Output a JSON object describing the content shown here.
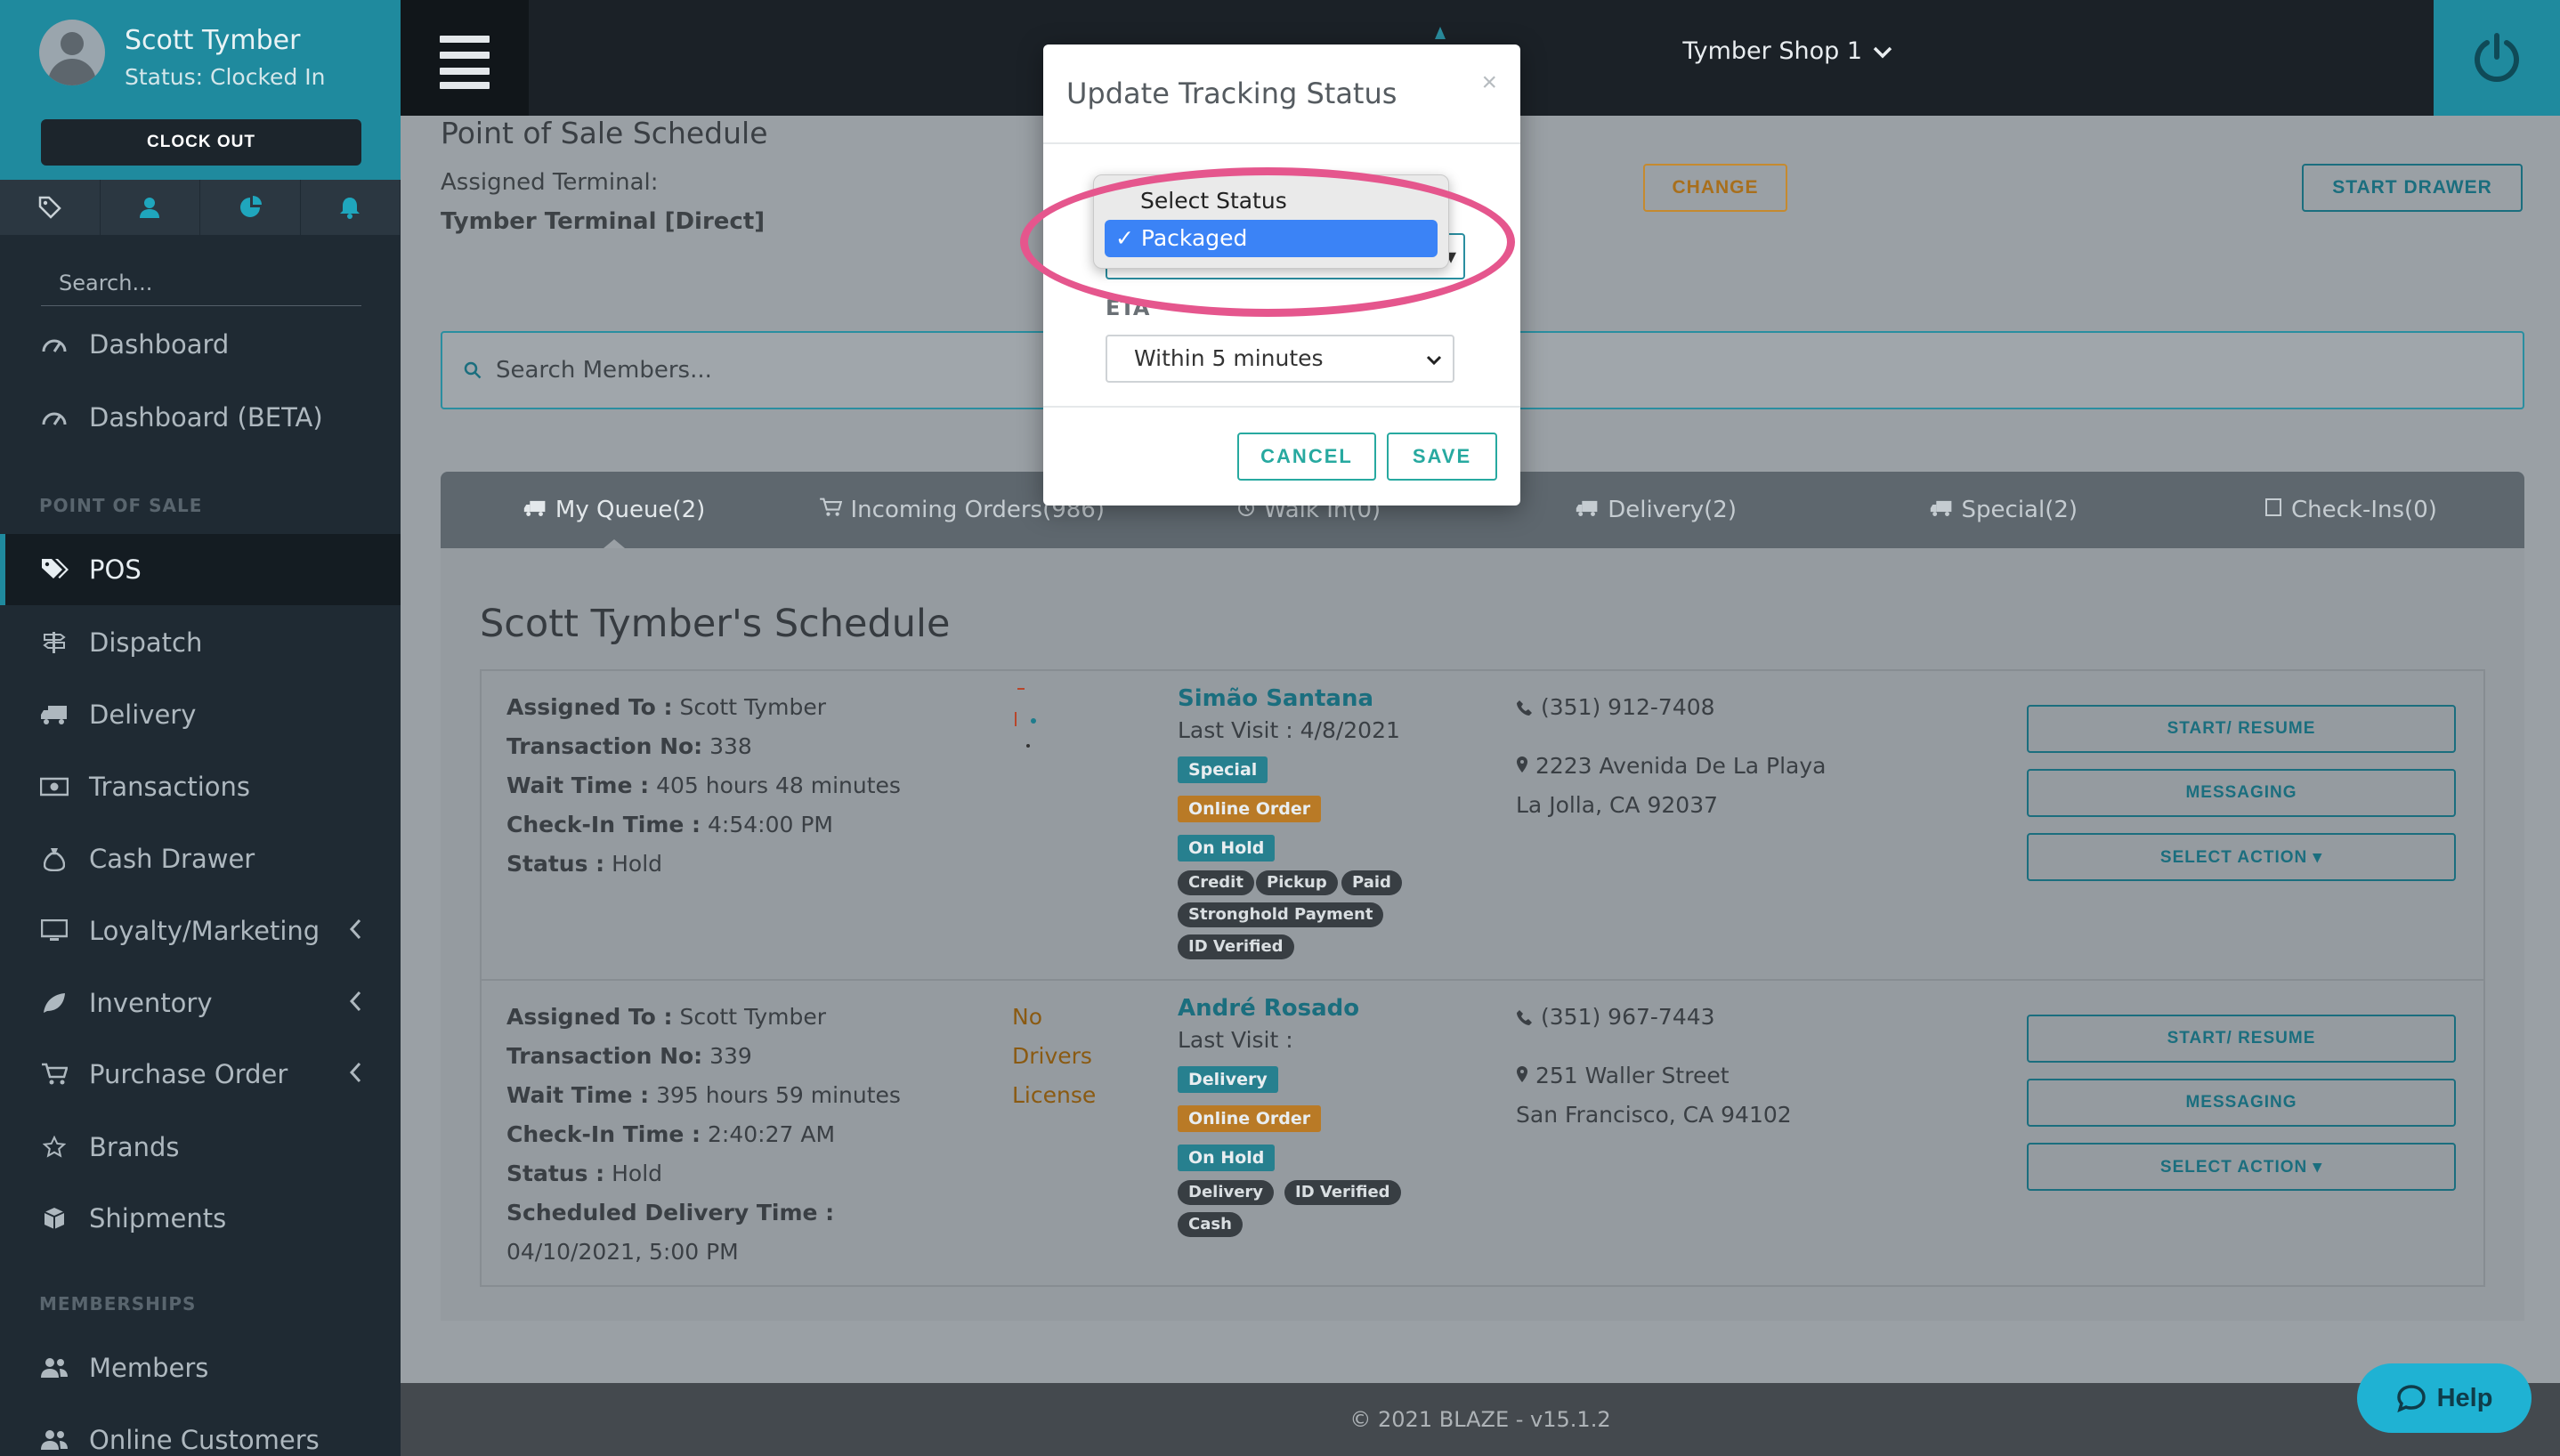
{
  "user": {
    "name": "Scott Tymber",
    "status": "Status: Clocked In",
    "clockout_label": "CLOCK OUT"
  },
  "sidebar": {
    "search_placeholder": "Search...",
    "sections": {
      "pos": "POINT OF SALE",
      "memberships": "MEMBERSHIPS"
    },
    "items": [
      {
        "label": "Dashboard"
      },
      {
        "label": "Dashboard (BETA)"
      },
      {
        "label": "POS"
      },
      {
        "label": "Dispatch"
      },
      {
        "label": "Delivery"
      },
      {
        "label": "Transactions"
      },
      {
        "label": "Cash Drawer"
      },
      {
        "label": "Loyalty/Marketing"
      },
      {
        "label": "Inventory"
      },
      {
        "label": "Purchase Order"
      },
      {
        "label": "Brands"
      },
      {
        "label": "Shipments"
      },
      {
        "label": "Members"
      },
      {
        "label": "Online Customers"
      }
    ]
  },
  "topbar": {
    "shop": "Tymber Shop 1"
  },
  "page": {
    "title": "Point of Sale Schedule",
    "terminal_label": "Assigned Terminal:",
    "terminal_value": "Tymber Terminal [Direct]",
    "change_label": "CHANGE",
    "start_drawer_label": "START DRAWER",
    "search_placeholder": "Search Members..."
  },
  "tabs": [
    {
      "label": "My Queue(2)"
    },
    {
      "label": "Incoming Orders(986)"
    },
    {
      "label": "Walk In(0)"
    },
    {
      "label": "Delivery(2)"
    },
    {
      "label": "Special(2)"
    },
    {
      "label": "Check-Ins(0)"
    }
  ],
  "schedule": {
    "title": "Scott Tymber's Schedule",
    "field_labels": {
      "assigned": "Assigned To :",
      "txn": "Transaction No:",
      "wait": "Wait Time :",
      "checkin": "Check-In Time :",
      "status": "Status :",
      "scheduled": "Scheduled Delivery Time :"
    },
    "rows": [
      {
        "assigned": "Scott Tymber",
        "txn": "338",
        "wait": "405 hours 48 minutes",
        "checkin": "4:54:00 PM",
        "status": "Hold",
        "customer": "Simão Santana",
        "last_visit": "Last Visit : 4/8/2021",
        "badges": [
          "Special",
          "Online Order",
          "On Hold"
        ],
        "pills": [
          "Credit",
          "Pickup",
          "Paid",
          "Stronghold Payment",
          "ID Verified"
        ],
        "phone": "(351) 912-7408",
        "addr1": "2223 Avenida De La Playa",
        "addr2": "La Jolla, CA 92037"
      },
      {
        "assigned": "Scott Tymber",
        "txn": "339",
        "wait": "395 hours 59 minutes",
        "checkin": "2:40:27 AM",
        "status": "Hold",
        "scheduled": "04/10/2021, 5:00 PM",
        "no_drivers": [
          "No",
          "Drivers",
          "License"
        ],
        "customer": "André Rosado",
        "last_visit": "Last Visit :",
        "badges": [
          "Delivery",
          "Online Order",
          "On Hold"
        ],
        "pills": [
          "Delivery",
          "ID Verified",
          "Cash"
        ],
        "phone": "(351) 967-7443",
        "addr1": "251 Waller Street",
        "addr2": "San Francisco, CA 94102"
      }
    ],
    "actions": {
      "start": "START/ RESUME",
      "messaging": "MESSAGING",
      "select": "SELECT ACTION ▾"
    }
  },
  "footer": "© 2021 BLAZE - v15.1.2",
  "help_label": "Help",
  "modal": {
    "title": "Update Tracking Status",
    "close": "×",
    "status_options": [
      "Select Status",
      "Packaged"
    ],
    "selected_status": "✓ Packaged",
    "eta_label": "ETA",
    "eta_value": "Within 5 minutes",
    "cancel_label": "CANCEL",
    "save_label": "SAVE"
  },
  "colors": {
    "brand": "#1f8a9e",
    "highlight": "#e5568d",
    "selected": "#3b83f6"
  }
}
